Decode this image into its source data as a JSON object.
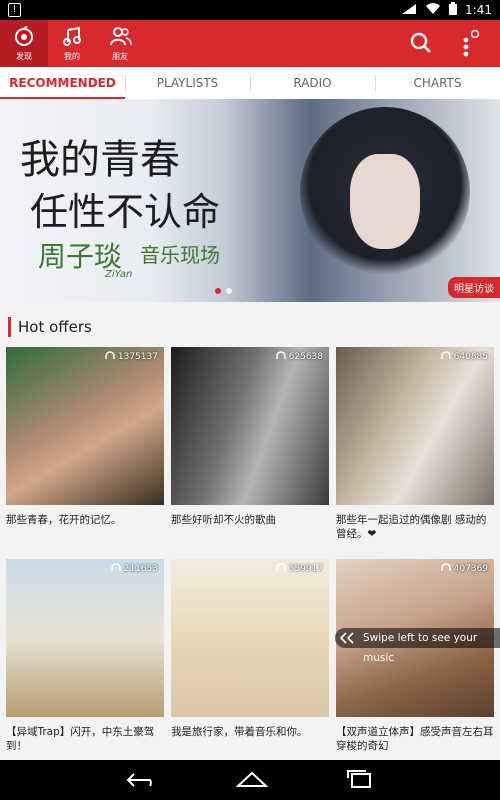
{
  "status": {
    "time": "1:41"
  },
  "nav": [
    {
      "label": "发现",
      "icon": "discover-icon"
    },
    {
      "label": "我的",
      "icon": "music-note-icon"
    },
    {
      "label": "朋友",
      "icon": "friends-icon"
    }
  ],
  "tabs": [
    "RECOMMENDED",
    "PLAYLISTS",
    "RADIO",
    "CHARTS"
  ],
  "banner": {
    "line1": "我的青春",
    "line2": "任性不认命",
    "artist": "周子琰",
    "artist_en": "ZiYan",
    "subtitle": "音乐现场",
    "tag": "明星访谈"
  },
  "section": {
    "title": "Hot offers",
    "cards": [
      {
        "count": "1375137",
        "caption": "那些青春，花开的记忆。"
      },
      {
        "count": "625638",
        "caption": "那些好听却不火的歌曲"
      },
      {
        "count": "640885",
        "caption": "那些年一起追过的偶像剧 感动的曾经。❤"
      },
      {
        "count": "211653",
        "caption": "【异域Trap】闪开，中东土豪驾到！"
      },
      {
        "count": "559917",
        "caption": "我是旅行家，带着音乐和你。"
      },
      {
        "count": "407369",
        "caption": "【双声道立体声】感受声音左右耳穿梭的奇幻"
      }
    ],
    "swipe_hint": "Swipe left to see your music"
  },
  "colors": {
    "accent": "#d8292f"
  }
}
